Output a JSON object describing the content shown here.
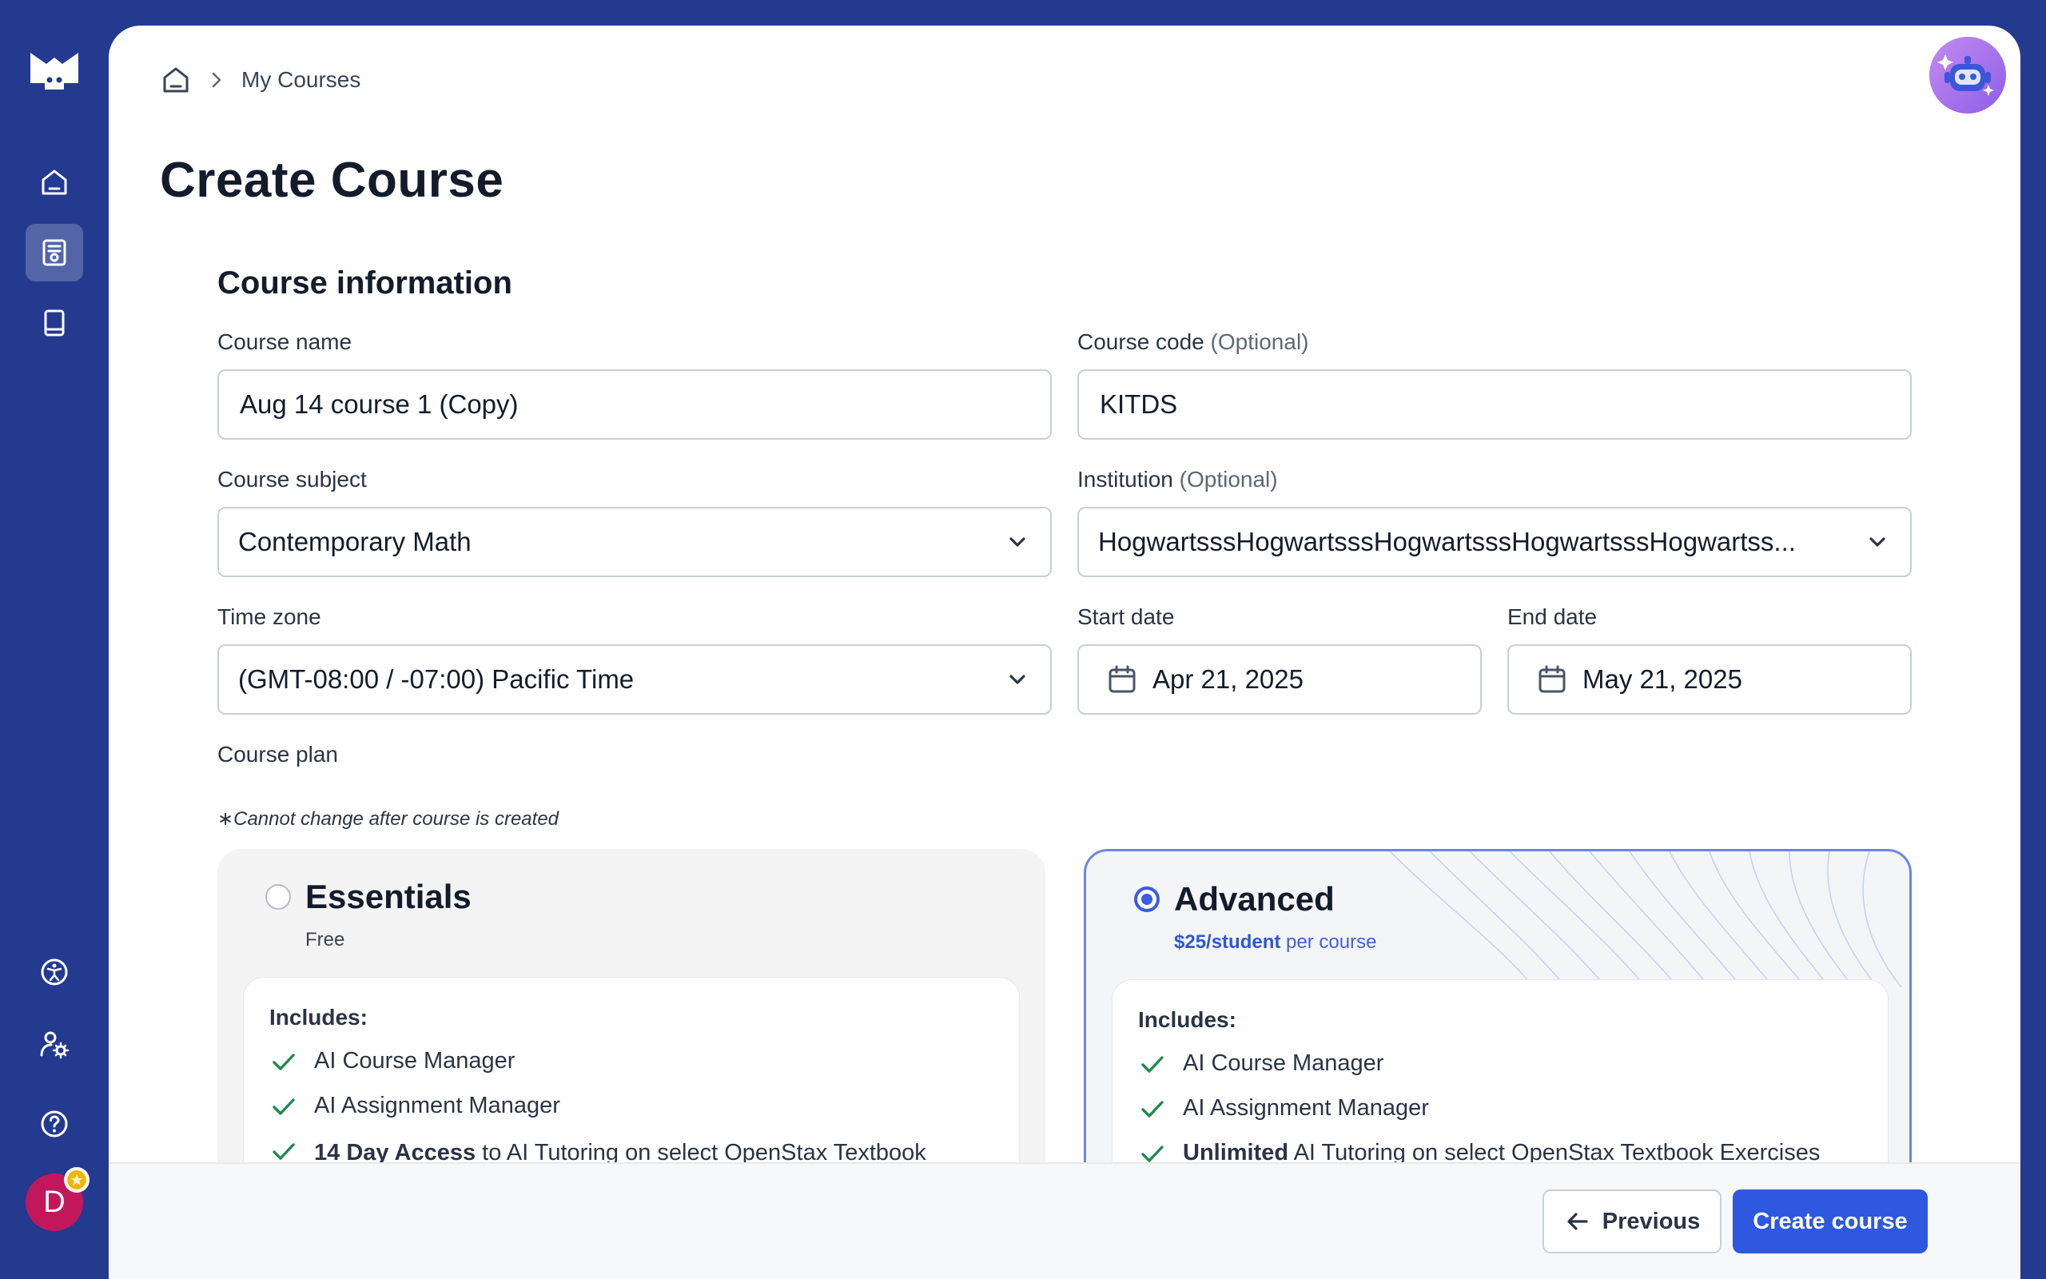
{
  "breadcrumb": {
    "home_icon": "home-icon",
    "current": "My Courses"
  },
  "page_title": "Create Course",
  "section_title": "Course information",
  "fields": {
    "course_name": {
      "label": "Course name",
      "value": "Aug 14 course 1 (Copy)"
    },
    "course_code": {
      "label": "Course code",
      "optional": "(Optional)",
      "value": "KITDS"
    },
    "course_subject": {
      "label": "Course subject",
      "value": "Contemporary Math"
    },
    "institution": {
      "label": "Institution",
      "optional": "(Optional)",
      "value": "HogwartsssHogwartsssHogwartsssHogwartsssHogwartss..."
    },
    "time_zone": {
      "label": "Time zone",
      "value": "(GMT-08:00 / -07:00) Pacific Time"
    },
    "start_date": {
      "label": "Start date",
      "value": "Apr 21, 2025"
    },
    "end_date": {
      "label": "End date",
      "value": "May 21, 2025"
    }
  },
  "course_plan": {
    "label": "Course plan",
    "note": "∗Cannot change after course is created",
    "plans": [
      {
        "name": "Essentials",
        "price": "Free",
        "selected": false,
        "includes_title": "Includes:",
        "features": [
          {
            "bold": "",
            "text": "AI Course Manager"
          },
          {
            "bold": "",
            "text": "AI Assignment Manager"
          },
          {
            "bold": "14 Day Access",
            "text": " to AI Tutoring on select OpenStax Textbook Exercises"
          }
        ]
      },
      {
        "name": "Advanced",
        "price_strong": "$25/student",
        "price_rest": " per course",
        "selected": true,
        "includes_title": "Includes:",
        "features": [
          {
            "bold": "",
            "text": "AI Course Manager"
          },
          {
            "bold": "",
            "text": "AI Assignment Manager"
          },
          {
            "bold": "Unlimited",
            "text": " AI Tutoring on select OpenStax Textbook Exercises"
          }
        ]
      }
    ]
  },
  "footer": {
    "previous_label": "Previous",
    "create_label": "Create course"
  },
  "user": {
    "initial": "D"
  },
  "colors": {
    "sidebar": "#233a8f",
    "primary": "#2f58e0",
    "check": "#1f8a4c",
    "avatar": "#c2185b"
  }
}
